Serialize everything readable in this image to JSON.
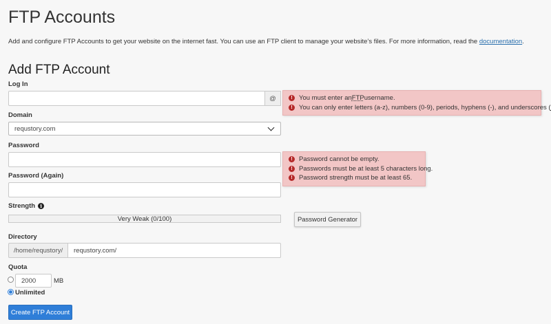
{
  "page": {
    "title": "FTP Accounts",
    "intro_text": "Add and configure FTP Accounts to get your website on the internet fast. You can use an FTP client to manage your website’s files. For more information, read the ",
    "intro_link": "documentation",
    "intro_end": "."
  },
  "form": {
    "section_title": "Add FTP Account",
    "login": {
      "label": "Log In",
      "value": "",
      "placeholder": "",
      "addon": "@"
    },
    "login_errors": [
      {
        "pre": "You must enter an ",
        "abbr": "FTP",
        "post": " username."
      },
      {
        "pre": "You can only enter letters (a-z), numbers (0-9), periods, hyphens (-), and underscores (",
        "abbr": "_",
        "post": ")."
      }
    ],
    "domain": {
      "label": "Domain",
      "selected": "requstory.com"
    },
    "password": {
      "label": "Password",
      "value": ""
    },
    "password_again": {
      "label": "Password (Again)",
      "value": ""
    },
    "password_errors": [
      "Password cannot be empty.",
      "Passwords must be at least 5 characters long.",
      "Password strength must be at least 65."
    ],
    "strength": {
      "label": "Strength",
      "text": "Very Weak (0/100)",
      "value": 0
    },
    "generator_button": "Password Generator",
    "directory": {
      "label": "Directory",
      "prefix": "/home/requstory/",
      "value": "requstory.com/"
    },
    "quota": {
      "label": "Quota",
      "value": "2000",
      "unit": "MB",
      "unlimited_label": "Unlimited",
      "selected": "unlimited"
    },
    "submit_button": "Create FTP Account"
  },
  "icons": {
    "error": "exclamation-circle-icon",
    "info": "info-circle-icon",
    "dropdown": "chevron-down-icon"
  },
  "colors": {
    "primary": "#2f7ed8",
    "error_bg": "#f2c6c6",
    "error_icon": "#b52828",
    "link": "#2a6fad"
  }
}
